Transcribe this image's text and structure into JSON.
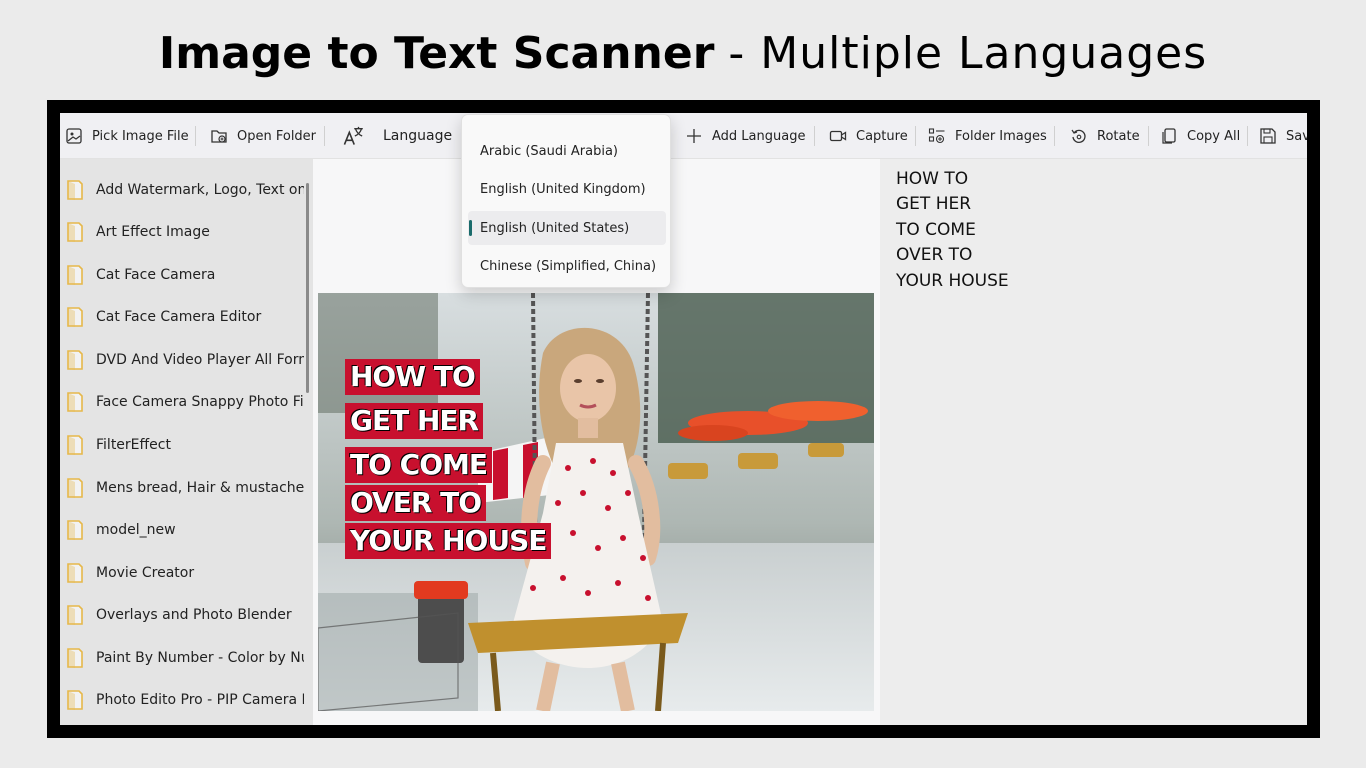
{
  "headline": {
    "bold": "Image to Text Scanner",
    "light": "- Multiple Languages"
  },
  "toolbar": {
    "pick_image": "Pick Image File",
    "open_folder": "Open Folder",
    "language": "Language",
    "add_language": "Add Language",
    "capture": "Capture",
    "folder_images": "Folder Images",
    "rotate": "Rotate",
    "copy_all": "Copy All",
    "save": "Save"
  },
  "language_dropdown": {
    "options": [
      "Arabic (Saudi Arabia)",
      "English (United Kingdom)",
      "English (United States)",
      "Chinese (Simplified, China)"
    ],
    "selected": "English (United States)"
  },
  "sidebar": {
    "items": [
      "Add Watermark, Logo, Text on I",
      "Art Effect Image",
      "Cat Face Camera",
      "Cat Face Camera Editor",
      "DVD And Video Player All Form",
      "Face Camera Snappy Photo Filt",
      "FilterEffect",
      "Mens bread, Hair & mustache",
      "model_new",
      "Movie Creator",
      "Overlays and Photo Blender",
      "Paint By Number - Color by Nu",
      "Photo Edito Pro - PIP Camera E"
    ]
  },
  "image_text": [
    "HOW TO",
    "GET HER",
    "TO COME",
    "OVER TO",
    "YOUR HOUSE"
  ],
  "ocr_result": [
    "HOW TO",
    "GET HER",
    "TO COME",
    "OVER TO",
    "YOUR HOUSE"
  ],
  "colors": {
    "accent": "#1a6b6b",
    "folder": "#e6b84a",
    "caption_red": "#c8102e"
  }
}
